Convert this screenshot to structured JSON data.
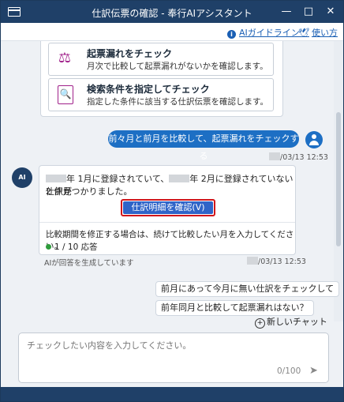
{
  "window": {
    "title": "仕訳伝票の確認 - 奉行AIアシスタント",
    "minimize": "—",
    "maximize": "□",
    "close": "✕"
  },
  "toolbar": {
    "guide_label": "AIガイドライン",
    "howto_label": "使い方"
  },
  "options": [
    {
      "title": "起票漏れをチェック",
      "desc": "月次で比較して起票漏れがないかを確認します。",
      "icon": "scale-icon"
    },
    {
      "title": "検索条件を指定してチェック",
      "desc": "指定した条件に該当する仕訳伝票を確認します。",
      "icon": "document-search-icon"
    }
  ],
  "user_message": {
    "text": "前々月と前月を比較して、起票漏れをチェックする",
    "time": "/03/13 12:53"
  },
  "ai": {
    "avatar_label": "AI",
    "line1_a": "年 1月に登録されていて、",
    "line1_b": "年 2月に登録されていない仕訳が",
    "line2": "2 件見つかりました。",
    "button_label": "仕訳明細を確認(V)",
    "note": "比較期間を修正する場合は、続けて比較したい月を入力してください。",
    "answers": "1 / 10 応答",
    "generated": "AIが回答を生成しています",
    "time": "/03/13 12:53"
  },
  "suggestions": [
    "前月にあって今月に無い仕訳をチェックして",
    "前年同月と比較して起票漏れはない？"
  ],
  "new_chat_label": "新しいチャット",
  "input": {
    "placeholder": "チェックしたい内容を入力してください。",
    "counter": "0/100"
  },
  "colors": {
    "titlebar": "#1f4068",
    "accent": "#1d6fc4",
    "button": "#2f64c8",
    "highlight": "#d1161b",
    "status": "#2e9c3c"
  }
}
